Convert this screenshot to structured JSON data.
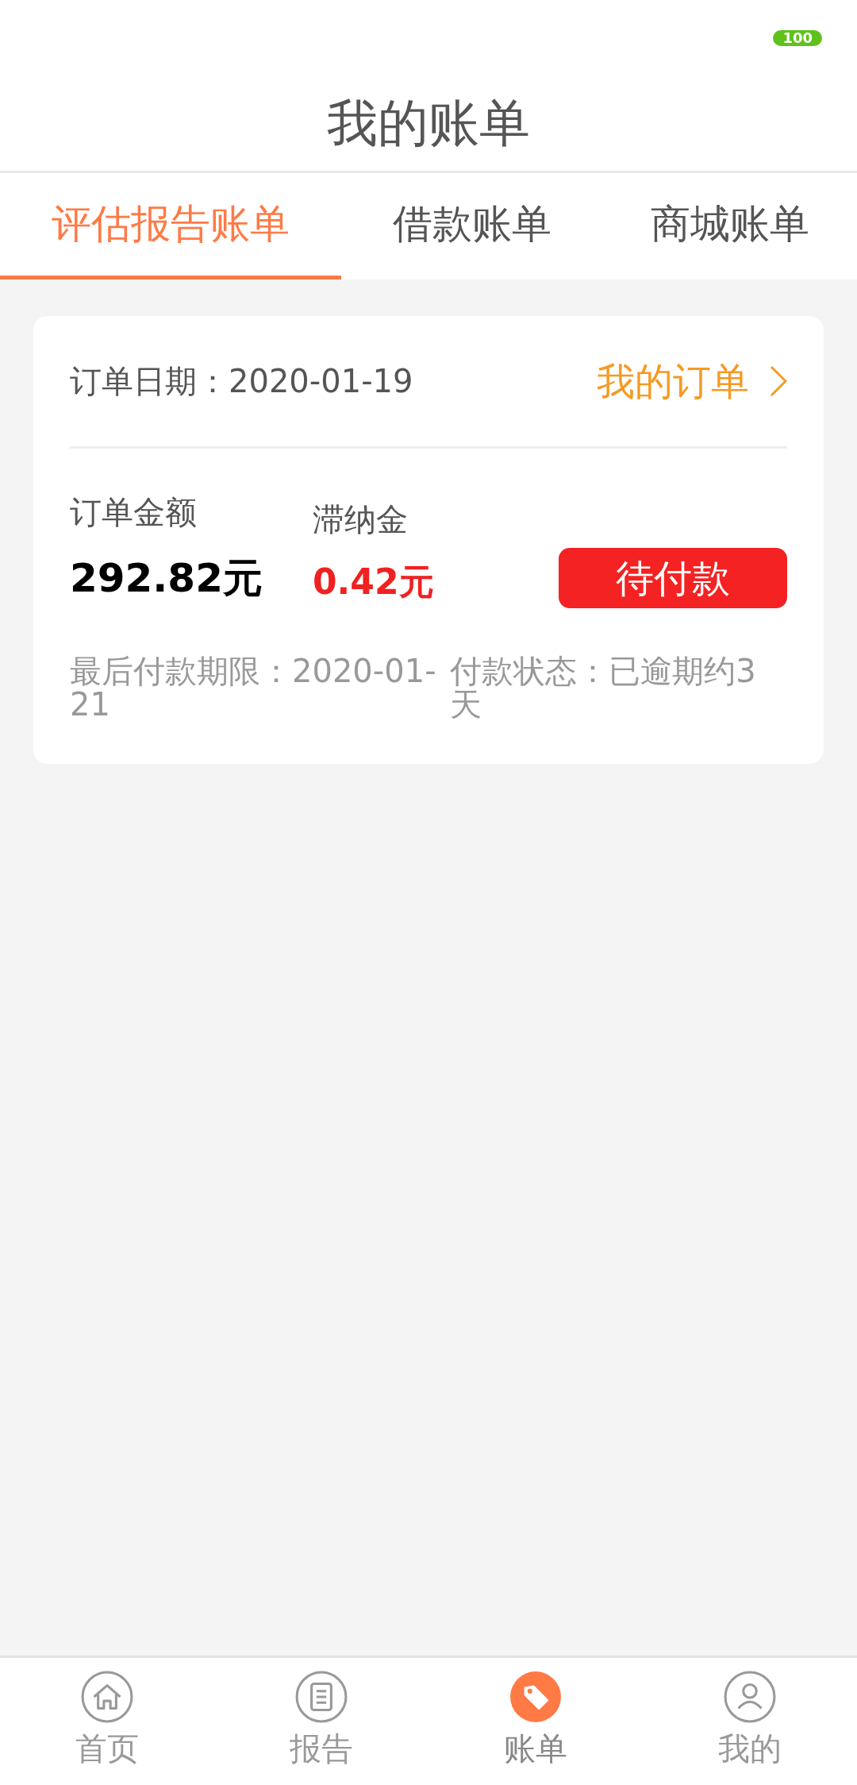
{
  "status_bar": {
    "battery": "100"
  },
  "title": "我的账单",
  "tabs": [
    {
      "label": "评估报告账单",
      "selected": true
    },
    {
      "label": "借款账单",
      "selected": false
    },
    {
      "label": "商城账单",
      "selected": false
    }
  ],
  "order_card": {
    "order_date": "订单日期：2020-01-19",
    "orders_link": "我的订单",
    "amount_label": "订单金额",
    "amount": "292.82元",
    "late_fee_label": "滞纳金",
    "late_fee": "0.42元",
    "pay_button": "待付款",
    "deadline": "最后付款期限：2020-01-21",
    "payment_status": "付款状态：已逾期约3天"
  },
  "bottom_nav": [
    {
      "kind": "home",
      "label": "首页",
      "selected": false
    },
    {
      "kind": "report",
      "label": "报告",
      "selected": false
    },
    {
      "kind": "bill",
      "label": "账单",
      "selected": true
    },
    {
      "kind": "profile",
      "label": "我的",
      "selected": false
    }
  ]
}
